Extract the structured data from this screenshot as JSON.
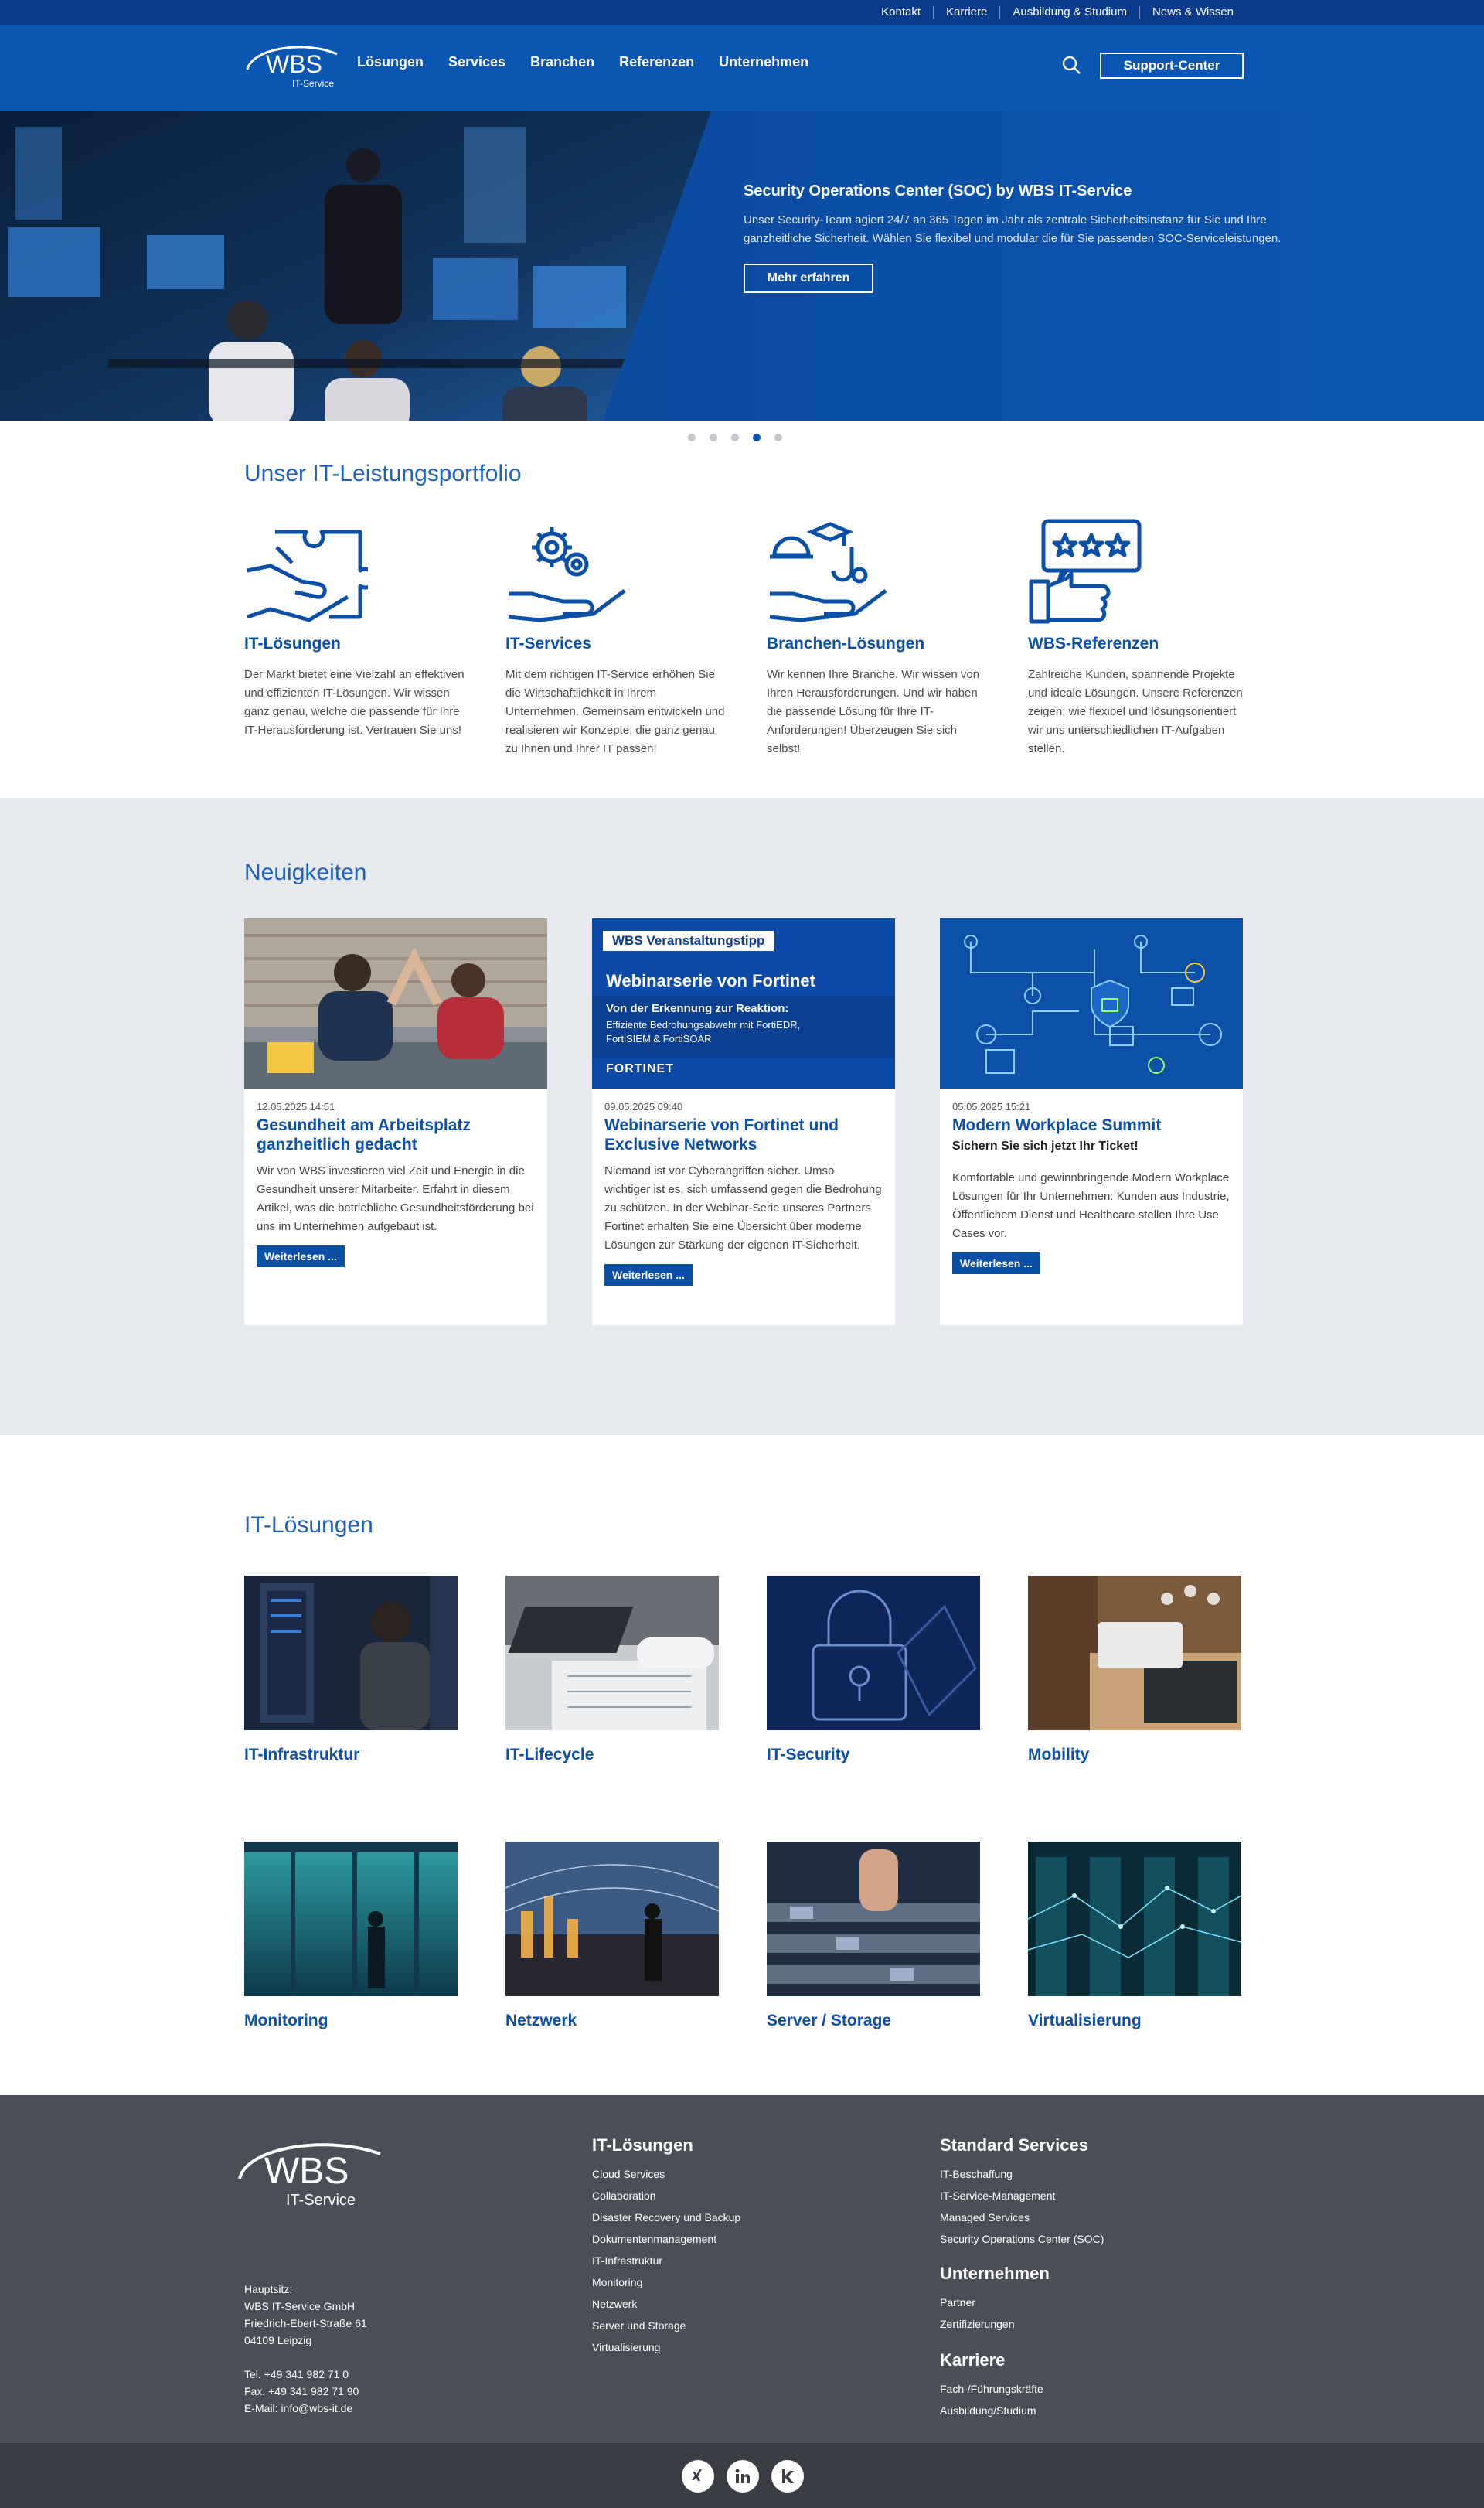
{
  "topbar": {
    "links": [
      "Kontakt",
      "Karriere",
      "Ausbildung & Studium",
      "News & Wissen"
    ]
  },
  "header": {
    "logo_text": "WBS",
    "logo_sub": "IT-Service",
    "nav": [
      "Lösungen",
      "Services",
      "Branchen",
      "Referenzen",
      "Unternehmen"
    ],
    "support_label": "Support-Center"
  },
  "hero": {
    "title": "Security Operations Center (SOC) by WBS IT-Service",
    "description": "Unser Security-Team agiert 24/7 an 365 Tagen im Jahr als zentrale Sicherheitsinstanz für Sie und Ihre ganzheitliche Sicherheit. Wählen Sie flexibel und modular die für Sie passenden SOC-Serviceleistungen.",
    "button": "Mehr erfahren",
    "active_slide": 4,
    "slide_count": 5
  },
  "portfolio": {
    "title": "Unser IT-Leistungsportfolio",
    "items": [
      {
        "title": "IT-Lösungen",
        "text": "Der Markt bietet eine Vielzahl an effektiven und effizienten IT-Lösungen. Wir wissen ganz genau, welche die passende für Ihre IT-Herausforderung ist. Vertrauen Sie uns!"
      },
      {
        "title": "IT-Services",
        "text": "Mit dem richtigen IT-Service erhöhen Sie die Wirtschaftlichkeit in Ihrem Unternehmen. Gemeinsam entwickeln und realisieren wir Konzepte, die ganz genau zu Ihnen und Ihrer IT passen!"
      },
      {
        "title": "Branchen-Lösungen",
        "text": "Wir kennen Ihre Branche. Wir wissen von Ihren Herausforderungen. Und wir haben die passende Lösung für Ihre IT-Anforderungen! Überzeugen Sie sich selbst!"
      },
      {
        "title": "WBS-Referenzen",
        "text": "Zahlreiche Kunden, spannende Projekte und ideale Lösungen. Unsere Referenzen zeigen, wie flexibel und lösungsorientiert wir uns unterschiedlichen IT-Aufgaben stellen."
      }
    ]
  },
  "news": {
    "title": "Neuigkeiten",
    "button": "Weiterlesen ...",
    "items": [
      {
        "date": "12.05.2025 14:51",
        "title": "Gesundheit am Arbeitsplatz ganzheitlich gedacht",
        "subtitle": "",
        "text": "Wir von WBS investieren viel Zeit und Energie in die Gesundheit unserer Mitarbeiter. Erfahrt in diesem Artikel, was die betriebliche Gesundheitsförderung bei uns im Unternehmen aufgebaut ist."
      },
      {
        "date": "09.05.2025 09:40",
        "title": "Webinarserie von Fortinet und Exclusive Networks",
        "subtitle": "",
        "text": "Niemand ist vor Cyberangriffen sicher. Umso wichtiger ist es, sich umfassend gegen die Bedrohung zu schützen. In der Webinar-Serie unseres Partners Fortinet erhalten Sie eine Übersicht über moderne Lösungen zur Stärkung der eigenen IT-Sicherheit."
      },
      {
        "date": "05.05.2025 15:21",
        "title": "Modern Workplace Summit",
        "subtitle": "Sichern Sie sich jetzt Ihr Ticket!",
        "text": "Komfortable und gewinnbringende Modern Workplace Lösungen für Ihr Unternehmen: Kunden aus Industrie, Öffentlichem Dienst und Healthcare stellen Ihre Use Cases vor."
      }
    ],
    "banner": {
      "tag": "WBS Veranstaltungstipp",
      "headline": "Webinarserie von Fortinet",
      "sub": "Von der Erkennung zur Reaktion:",
      "line1": "Effiziente Bedrohungsabwehr mit FortiEDR,",
      "line2": "FortiSIEM & FortiSOAR",
      "brand": "FORTINET"
    }
  },
  "solutions": {
    "title": "IT-Lösungen",
    "items": [
      "IT-Infrastruktur",
      "IT-Lifecycle",
      "IT-Security",
      "Mobility",
      "Monitoring",
      "Netzwerk",
      "Server / Storage",
      "Virtualisierung"
    ]
  },
  "footer": {
    "address": [
      "Hauptsitz:",
      "WBS IT-Service GmbH",
      "Friedrich-Ebert-Straße 61",
      "04109 Leipzig",
      "",
      "Tel. +49 341 982 71 0",
      "Fax. +49 341 982 71 90",
      "E-Mail: info@wbs-it.de"
    ],
    "col1": {
      "head": "IT-Lösungen",
      "links": [
        "Cloud Services",
        "Collaboration",
        "Disaster Recovery und Backup",
        "Dokumentenmanagement",
        "IT-Infrastruktur",
        "Monitoring",
        "Netzwerk",
        "Server und Storage",
        "Virtualisierung"
      ]
    },
    "col2": {
      "head": "Standard Services",
      "links": [
        "IT-Beschaffung",
        "IT-Service-Management",
        "Managed Services",
        "Security Operations Center (SOC)"
      ]
    },
    "col3": {
      "head": "Unternehmen",
      "links": [
        "Partner",
        "Zertifizierungen"
      ]
    },
    "col4": {
      "head": "Karriere",
      "links": [
        "Fach-/Führungskräfte",
        "Ausbildung/Studium"
      ]
    },
    "social": [
      "xing-icon",
      "linkedin-icon",
      "kununu-icon"
    ]
  },
  "colors": {
    "brand": "#0b55b3",
    "dark_brand": "#0b3c8c",
    "footer": "#4a4e57"
  }
}
